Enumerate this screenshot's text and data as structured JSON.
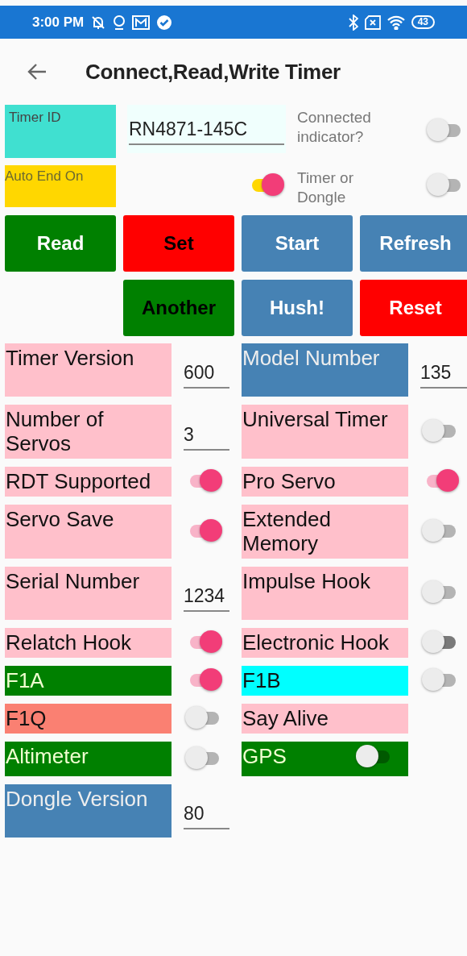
{
  "status_bar": {
    "time": "3:00 PM",
    "battery": "43"
  },
  "toolbar": {
    "title": "Connect,Read,Write Timer"
  },
  "timer_id": {
    "label": "Timer ID",
    "color": "#40e0d0",
    "value": "RN4871-145C"
  },
  "connected": {
    "label": "Connected indicator?",
    "on": false
  },
  "auto_end": {
    "label": "Auto End On",
    "color": "#ffd700",
    "on": true
  },
  "timer_or_dongle": {
    "label": "Timer or Dongle",
    "on": false
  },
  "buttons": [
    {
      "label": "Read",
      "color": "#008000",
      "kind": "light"
    },
    {
      "label": "Set",
      "color": "#ff0000",
      "kind": "dark"
    },
    {
      "label": "Start",
      "color": "#4682b4",
      "kind": "light"
    },
    {
      "label": "Refresh",
      "color": "#4682b4",
      "kind": "light"
    },
    {
      "label": "Another",
      "color": "#008000",
      "kind": "dark"
    },
    {
      "label": "Hush!",
      "color": "#4682b4",
      "kind": "light"
    },
    {
      "label": "Reset",
      "color": "#ff0000",
      "kind": "light"
    }
  ],
  "settings": [
    {
      "label": "Timer Version",
      "color": "#ffc0cb",
      "kind": "number",
      "value": "600"
    },
    {
      "label": "Model Number",
      "color": "#4682b4",
      "kind": "number",
      "value": "135"
    },
    {
      "label": "Number of Servos",
      "color": "#ffc0cb",
      "kind": "number",
      "value": "3"
    },
    {
      "label": "Universal Timer",
      "color": "#ffc0cb",
      "kind": "switch",
      "on": false
    },
    {
      "label": "RDT Supported",
      "color": "#ffc0cb",
      "kind": "switch",
      "on": true
    },
    {
      "label": "Pro Servo",
      "color": "#ffc0cb",
      "kind": "switch",
      "on": true
    },
    {
      "label": "Servo Save",
      "color": "#ffc0cb",
      "kind": "switch",
      "on": true
    },
    {
      "label": "Extended Memory",
      "color": "#ffc0cb",
      "kind": "switch",
      "on": false
    },
    {
      "label": "Serial Number",
      "color": "#ffc0cb",
      "kind": "number",
      "value": "1234"
    },
    {
      "label": "Impulse Hook",
      "color": "#ffc0cb",
      "kind": "switch",
      "on": false
    },
    {
      "label": "Relatch Hook",
      "color": "#ffc0cb",
      "kind": "switch",
      "on": true
    },
    {
      "label": "Electronic Hook",
      "color": "#ffc0cb",
      "kind": "switch",
      "on": false
    },
    {
      "label": "F1A",
      "color": "#008000",
      "kind": "switch",
      "on": true
    },
    {
      "label": "F1B",
      "color": "#00ffff",
      "kind": "switch",
      "on": false
    },
    {
      "label": "F1Q",
      "color": "#fa8072",
      "kind": "switch",
      "on": false
    },
    {
      "label": "Say Alive",
      "color": "#ffc0cb",
      "kind": "plain"
    },
    {
      "label": "Altimeter",
      "color": "#008000",
      "kind": "switch",
      "on": false
    },
    {
      "label": "GPS",
      "color": "#008000",
      "kind": "inline-switch",
      "on": false
    },
    {
      "label": "Dongle Version",
      "color": "#4682b4",
      "kind": "number",
      "value": "80"
    }
  ]
}
